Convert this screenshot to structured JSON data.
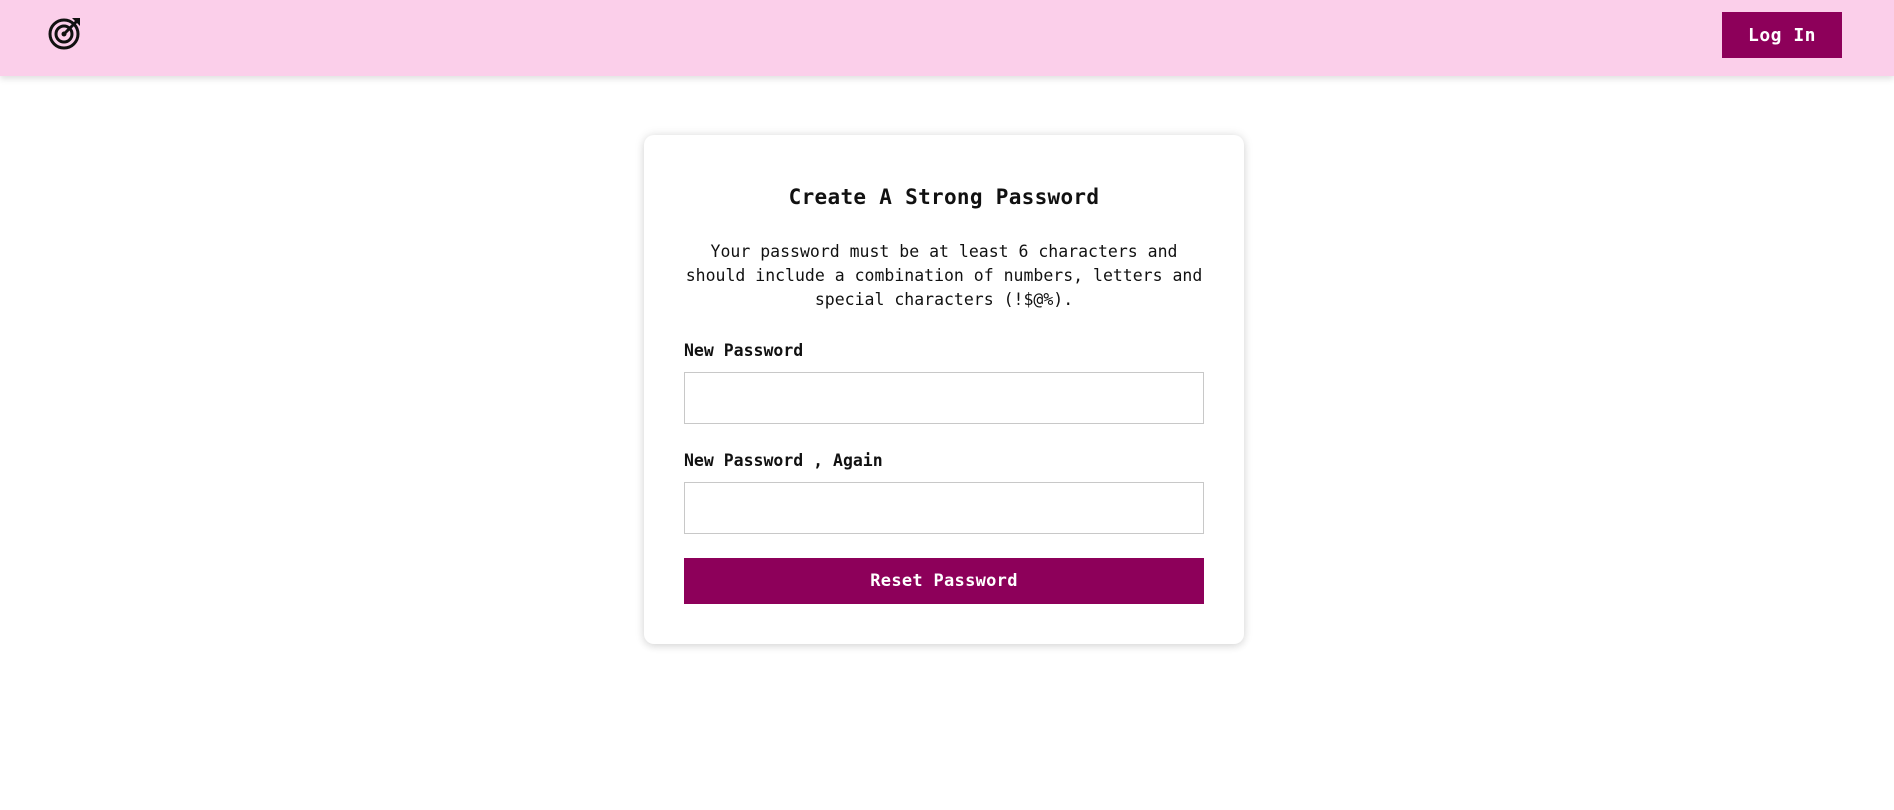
{
  "header": {
    "logo_icon": "target-arrow-icon",
    "login_label": "Log In",
    "background_color": "#fbcfea",
    "accent_color": "#8d005a"
  },
  "reset_form": {
    "title": "Create A Strong Password",
    "description": "Your password must be at least 6 characters and should include a combination of numbers, letters and special characters (!$@%).",
    "new_password": {
      "label": "New Password",
      "value": "",
      "placeholder": ""
    },
    "confirm_password": {
      "label": "New Password , Again",
      "value": "",
      "placeholder": ""
    },
    "submit_label": "Reset Password"
  }
}
